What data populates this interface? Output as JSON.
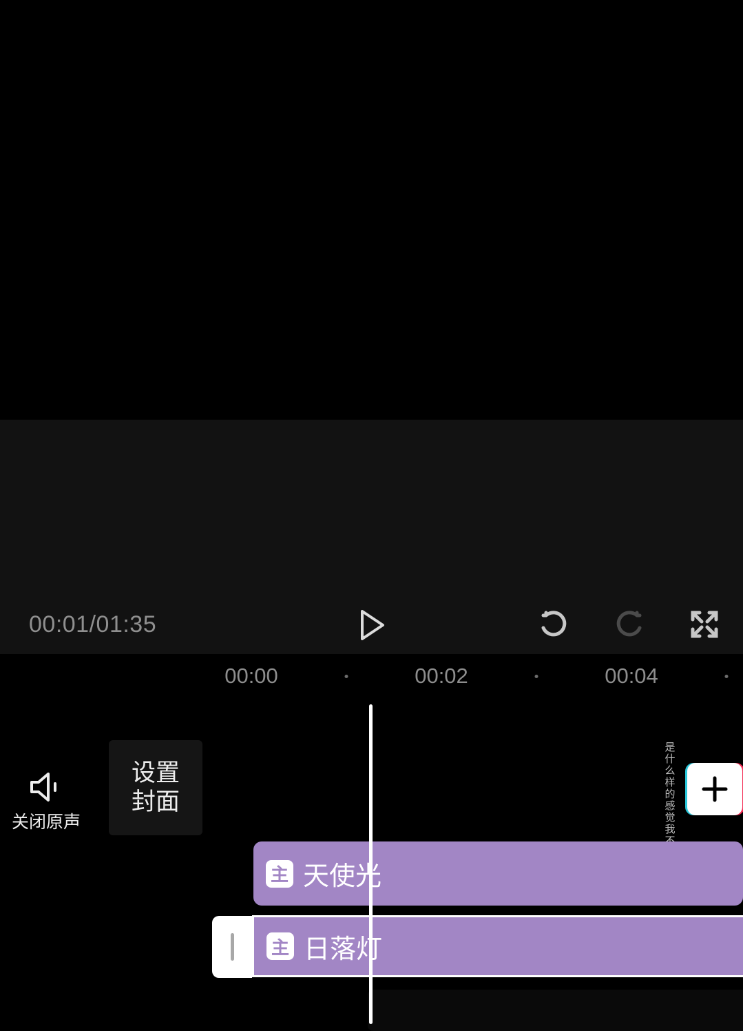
{
  "playback": {
    "current_time": "00:01",
    "total_time": "01:35"
  },
  "ruler": {
    "ticks": [
      "00:00",
      "00:02",
      "00:04"
    ]
  },
  "sidebar": {
    "mute_label": "关闭原声",
    "cover_label_line1": "设置",
    "cover_label_line2": "封面"
  },
  "video_thumb_chars": [
    "是",
    "什",
    "么",
    "样",
    "的",
    "感",
    "觉",
    "我",
    "不"
  ],
  "tracks": {
    "effect1_label": "天使光",
    "effect1_icon": "主",
    "effect2_label": "日落灯",
    "effect2_icon": "主"
  },
  "colors": {
    "track_purple": "#a286c5"
  }
}
